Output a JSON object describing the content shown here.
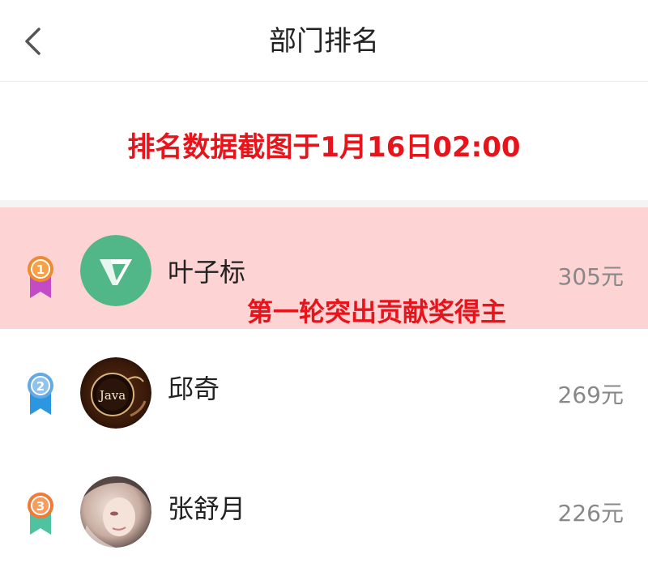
{
  "header": {
    "title": "部门排名",
    "back_icon": "chevron-left-icon"
  },
  "notice": {
    "text": "排名数据截图于1月16日02:00",
    "color": "#e8141c"
  },
  "ranking": [
    {
      "rank": "1",
      "medal_color": "#f08a2d",
      "ribbon_color": "#c44bc6",
      "name": "叶子标",
      "amount": "305元",
      "highlighted": true,
      "award": "第一轮突出贡献奖得主",
      "avatar": "green-y-logo"
    },
    {
      "rank": "2",
      "medal_color": "#63a9e6",
      "ribbon_color": "#2c96e0",
      "name": "邱奇",
      "amount": "269元",
      "highlighted": false,
      "avatar": "java-coffee"
    },
    {
      "rank": "3",
      "medal_color": "#f07a36",
      "ribbon_color": "#4fc3a0",
      "name": "张舒月",
      "amount": "226元",
      "highlighted": false,
      "avatar": "portrait"
    }
  ],
  "colors": {
    "highlight_bg": "#fdd3d4",
    "accent_red": "#e8141c",
    "amount_gray": "#888888"
  }
}
